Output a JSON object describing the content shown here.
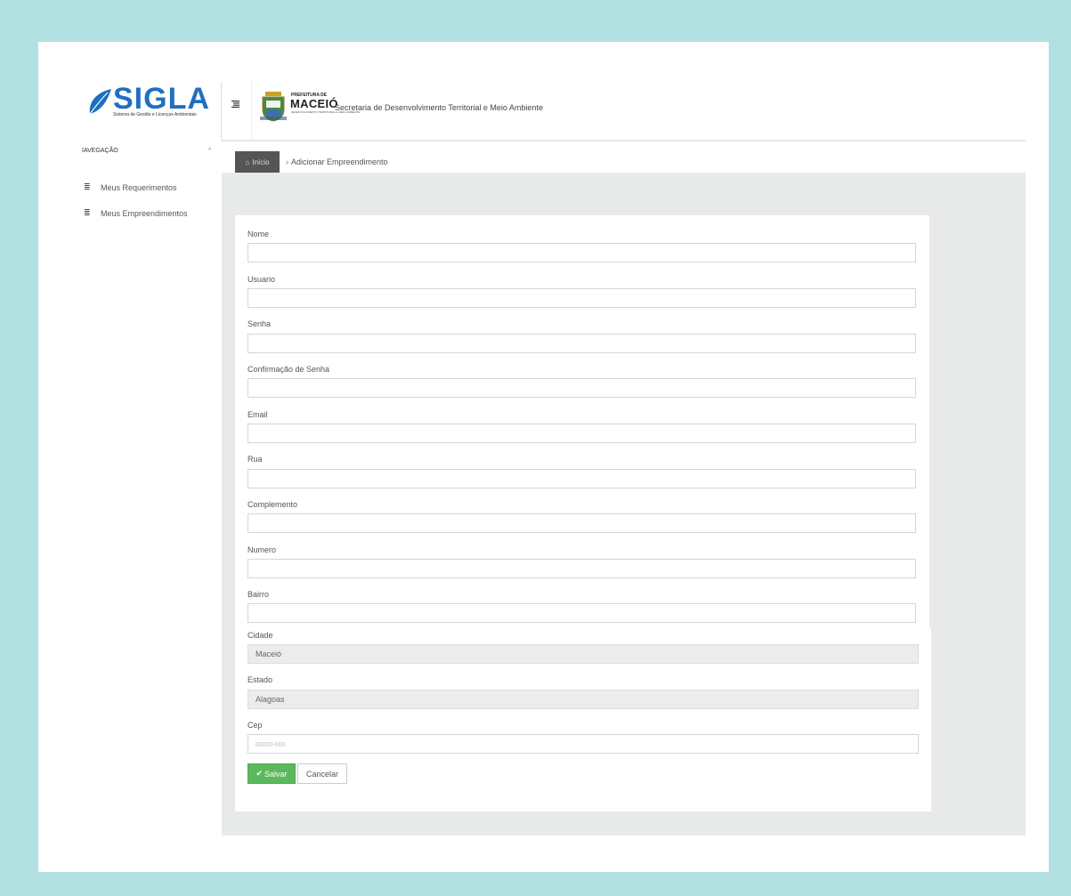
{
  "brand": {
    "name": "SIGLA",
    "tagline": "Sistema de Gestão e Licenças Ambientais"
  },
  "header": {
    "prefeitura_small": "PREFEITURA DE",
    "prefeitura_city": "MACEIÓ",
    "prefeitura_sub": "DESENVOLVIMENTO TERRITORIAL E MEIO AMBIENTE",
    "secretaria": "Secretaria de Desenvolvimento Territorial e Meio Ambiente"
  },
  "sidebar": {
    "header": "IAVEGAÇÃO",
    "items": [
      {
        "label": "Meus Requerimentos",
        "icon": "list-icon"
      },
      {
        "label": "Meus Empreendimentos",
        "icon": "list-icon"
      }
    ]
  },
  "breadcrumb": {
    "home": "Início",
    "separator": "›",
    "current": "Adicionar Empreendimento"
  },
  "form": {
    "nome_label": "Nome",
    "usuario_label": "Usuario",
    "senha_label": "Senha",
    "confirmacao_label": "Confirmação de Senha",
    "email_label": "Email",
    "rua_label": "Rua",
    "complemento_label": "Complemento",
    "numero_label": "Numero",
    "bairro_label": "Bairro",
    "cidade_label": "Cidade",
    "cidade_value": "Maceió",
    "estado_label": "Estado",
    "estado_value": "Alagoas",
    "cep_label": "Cep",
    "cep_placeholder": "00000-000",
    "save_label": "Salvar",
    "cancel_label": "Cancelar"
  },
  "colors": {
    "outer_background": "#b2dfdf",
    "brand_blue": "#1f6fc0",
    "save_green": "#5cb85c",
    "breadcrumb_home": "#555555"
  }
}
